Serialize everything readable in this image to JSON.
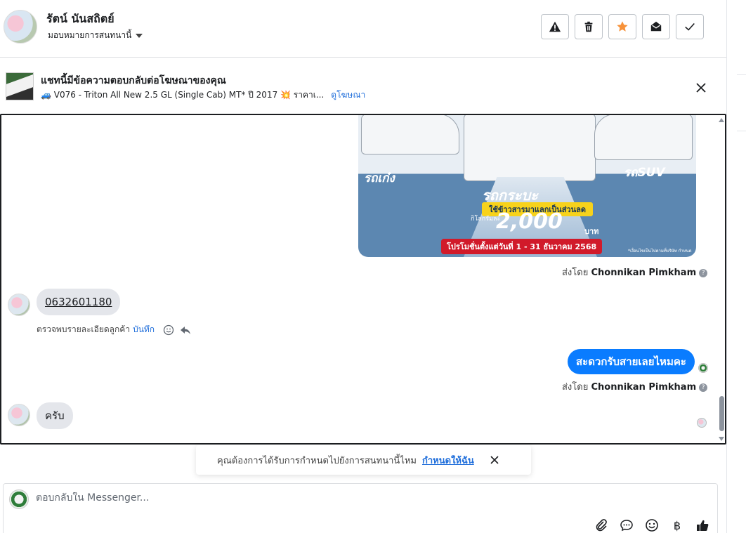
{
  "header": {
    "contact_name": "รัตน์ นันสถิตย์",
    "assign_label": "มอบหมายการสนทนานี้",
    "buttons": {
      "spam": "alert-triangle-icon",
      "delete": "trash-icon",
      "star": "star-icon",
      "mark_unread": "envelope-open-icon",
      "done": "check-icon"
    },
    "star_color": "#f7923a"
  },
  "ad_bar": {
    "title": "แชทนี้มีข้อความตอบกลับต่อโฆษณาของคุณ",
    "subtitle": "🚙 V076 - Triton All New 2.5 GL (Single Cab) MT* ปี 2017 💥 ราคาเ...",
    "view_ad_link": "ดูโฆษณา"
  },
  "promo_image": {
    "label_sedan": "รถเก๋ง",
    "label_suv": "รถSUV",
    "label_pickup": "รถกระบะ",
    "pill": "ใช้ข้าวสารมาแลกเป็นส่วนลด",
    "per_km": "กิโลกรัมละ",
    "price": "2,000",
    "unit": "บาท",
    "date": "โปรโมชั่นตั้งแต่วันที่ 1 - 31 ธันวาคม 2568",
    "fine_print": "*เงื่อนไขเป็นไปตามที่บริษัท กำหนด"
  },
  "messages": {
    "sent_by_prefix": "ส่งโดย",
    "sender_name": "Chonnikan Pimkham",
    "phone": "0632601180",
    "detect_text": "ตรวจพบรายละเอียดลูกค้า",
    "save_link": "บันทึก",
    "outgoing": "สะดวกรับสายเลยไหมคะ",
    "incoming_last": "ครับ"
  },
  "reminder": {
    "text": "คุณต้องการได้รับการกำหนดไปยังการสนทนานี้ไหม",
    "action": "กำหนดให้ฉัน"
  },
  "composer": {
    "placeholder": "ตอบกลับใน Messenger...",
    "baht_symbol": "฿"
  },
  "colors": {
    "messenger_blue": "#0a7cff",
    "link_blue": "#216fdb"
  }
}
